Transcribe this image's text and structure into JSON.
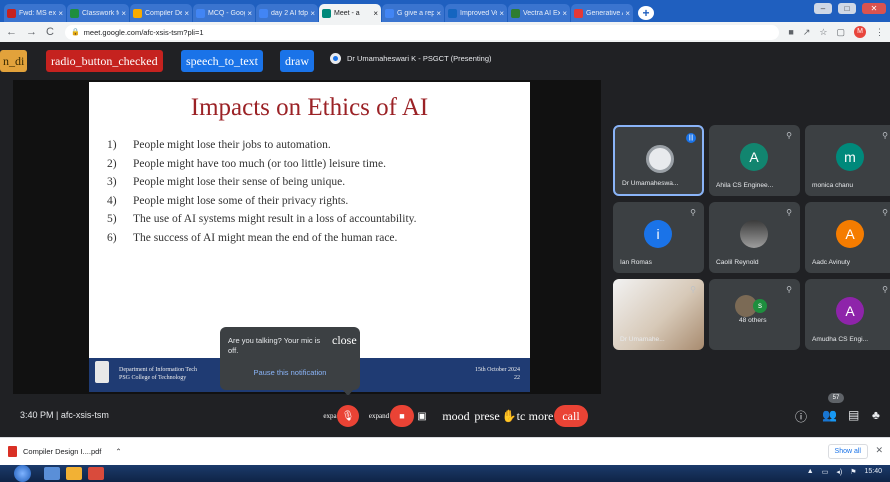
{
  "browser": {
    "tabs": [
      {
        "label": "Fwd: MS exar",
        "fav_color": "#c5221f",
        "active": false
      },
      {
        "label": "Classwork fo",
        "fav_color": "#1e8e3e",
        "active": false
      },
      {
        "label": "Compiler Des",
        "fav_color": "#f9ab00",
        "active": false
      },
      {
        "label": "MCQ - Googl",
        "fav_color": "#4285f4",
        "active": false
      },
      {
        "label": "day 2 AI fdp",
        "fav_color": "#4285f4",
        "active": false
      },
      {
        "label": "Meet - a",
        "fav_color": "#00897b",
        "active": true
      },
      {
        "label": "G give a report",
        "fav_color": "#4285f4",
        "active": false
      },
      {
        "label": "Improved Ve",
        "fav_color": "#1565c0",
        "active": false
      },
      {
        "label": "Vectra AI Exp",
        "fav_color": "#2e7d32",
        "active": false
      },
      {
        "label": "Generative A",
        "fav_color": "#e53935",
        "active": false
      }
    ],
    "url": "meet.google.com/afc-xsis-tsm?pli=1",
    "profile_initial": "M"
  },
  "extension_bar": {
    "btn1": "n_di",
    "btn2": "radio_button_checked",
    "btn3": "speech_to_text",
    "btn4": "draw",
    "presenting": "Dr Umamaheswari K - PSGCT (Presenting)"
  },
  "slide": {
    "title": "Impacts on Ethics of AI",
    "points": [
      {
        "n": "1)",
        "t": "People might lose their jobs to automation."
      },
      {
        "n": "2)",
        "t": "People might have too much (or too little) leisure time."
      },
      {
        "n": "3)",
        "t": "People might lose their sense of being unique."
      },
      {
        "n": "4)",
        "t": "People might lose some of their privacy rights."
      },
      {
        "n": "5)",
        "t": "The use of AI systems might result in a loss of accountability."
      },
      {
        "n": "6)",
        "t": "The success of AI might mean the end of the human race."
      }
    ],
    "footer_left_1": "Department of Information Tech",
    "footer_left_2": "PSG College of Technology",
    "footer_right_1": "15th October 2024",
    "footer_right_2": "22"
  },
  "tooltip": {
    "text": "Are you talking? Your mic is off.",
    "close": "close",
    "action": "Pause this notification"
  },
  "participants": [
    {
      "name": "Dr Umamaheswa...",
      "initial": "",
      "color": "#3c4043"
    },
    {
      "name": "Ahila CS Enginee...",
      "initial": "A",
      "color": "#12856f"
    },
    {
      "name": "monica chanu",
      "initial": "m",
      "color": "#00897b"
    },
    {
      "name": "Ian Romas",
      "initial": "i",
      "color": "#1a73e8"
    },
    {
      "name": "Caolil Reynold",
      "initial": "",
      "color": "#3c4043"
    },
    {
      "name": "Aadc Avinuty",
      "initial": "A",
      "color": "#f57c00"
    },
    {
      "name": "Dr Umamahe...",
      "initial": "",
      "color": "#3c4043"
    },
    {
      "name": "48 others",
      "initial": "",
      "color": "#3c4043"
    },
    {
      "name": "Amudha CS Engi...",
      "initial": "A",
      "color": "#8e24aa"
    }
  ],
  "others_initial": "s",
  "controls": {
    "time": "3:40 PM",
    "separator": "|",
    "meeting_code": "afc-xsis-tsm",
    "expand1": "expa",
    "expand2": "expand",
    "mood": "mood",
    "present": "prese",
    "more": "more",
    "call": "call",
    "cc": "tc",
    "participants_count": "57"
  },
  "download": {
    "file": "Compiler Design I....pdf",
    "show_all": "Show all"
  },
  "taskbar": {
    "clock": "15:40"
  }
}
